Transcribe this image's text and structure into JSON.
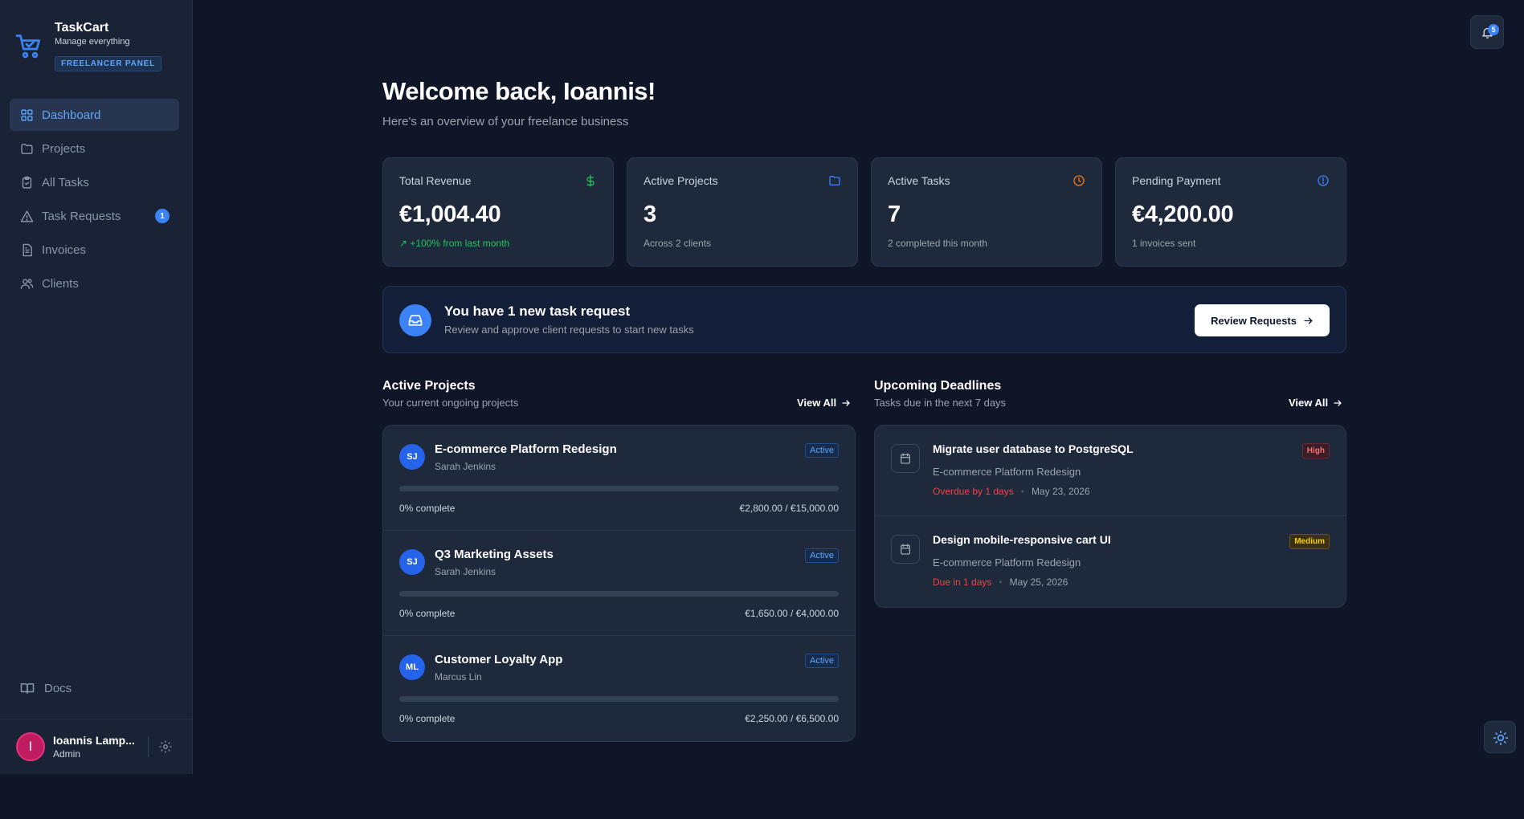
{
  "app": {
    "name": "TaskCart",
    "tagline": "Manage everything",
    "panel_badge": "FREELANCER PANEL"
  },
  "sidebar": {
    "items": [
      {
        "label": "Dashboard",
        "icon": "grid-icon",
        "active": true
      },
      {
        "label": "Projects",
        "icon": "folder-icon"
      },
      {
        "label": "All Tasks",
        "icon": "clipboard-icon"
      },
      {
        "label": "Task Requests",
        "icon": "alert-triangle-icon",
        "badge": "1"
      },
      {
        "label": "Invoices",
        "icon": "file-text-icon"
      },
      {
        "label": "Clients",
        "icon": "users-icon"
      }
    ],
    "docs_label": "Docs"
  },
  "user": {
    "initial": "I",
    "name": "Ioannis Lamp...",
    "role": "Admin"
  },
  "notifications": {
    "count": "5"
  },
  "header": {
    "title": "Welcome back, Ioannis!",
    "subtitle": "Here's an overview of your freelance business"
  },
  "stats": [
    {
      "label": "Total Revenue",
      "value": "€1,004.40",
      "note": "+100% from last month",
      "icon": "dollar-icon",
      "color": "#22c55e"
    },
    {
      "label": "Active Projects",
      "value": "3",
      "note": "Across 2 clients",
      "icon": "folder-icon",
      "color": "#3b82f6"
    },
    {
      "label": "Active Tasks",
      "value": "7",
      "note": "2 completed this month",
      "icon": "clock-icon",
      "color": "#f97316"
    },
    {
      "label": "Pending Payment",
      "value": "€4,200.00",
      "note": "1 invoices sent",
      "icon": "info-icon",
      "color": "#3b82f6"
    }
  ],
  "banner": {
    "title": "You have 1 new task request",
    "subtitle": "Review and approve client requests to start new tasks",
    "button": "Review Requests"
  },
  "projects_section": {
    "title": "Active Projects",
    "subtitle": "Your current ongoing projects",
    "view_all": "View All",
    "items": [
      {
        "initials": "SJ",
        "name": "E-commerce Platform Redesign",
        "client": "Sarah Jenkins",
        "status": "Active",
        "progress_percent": 0,
        "progress_label": "0% complete",
        "amount": "€2,800.00 / €15,000.00"
      },
      {
        "initials": "SJ",
        "name": "Q3 Marketing Assets",
        "client": "Sarah Jenkins",
        "status": "Active",
        "progress_percent": 0,
        "progress_label": "0% complete",
        "amount": "€1,650.00 / €4,000.00"
      },
      {
        "initials": "ML",
        "name": "Customer Loyalty App",
        "client": "Marcus Lin",
        "status": "Active",
        "progress_percent": 0,
        "progress_label": "0% complete",
        "amount": "€2,250.00 / €6,500.00"
      }
    ]
  },
  "deadlines_section": {
    "title": "Upcoming Deadlines",
    "subtitle": "Tasks due in the next 7 days",
    "view_all": "View All",
    "items": [
      {
        "title": "Migrate user database to PostgreSQL",
        "project": "E-commerce Platform Redesign",
        "due": "Overdue by 1 days",
        "date": "May 23, 2026",
        "priority": "High"
      },
      {
        "title": "Design mobile-responsive cart UI",
        "project": "E-commerce Platform Redesign",
        "due": "Due in 1 days",
        "date": "May 25, 2026",
        "priority": "Medium"
      }
    ]
  },
  "colors": {
    "accent": "#3b82f6",
    "background": "#0e1627",
    "card": "#1e293b",
    "danger": "#ef4444",
    "success": "#22c55e",
    "warning": "#facc15"
  }
}
